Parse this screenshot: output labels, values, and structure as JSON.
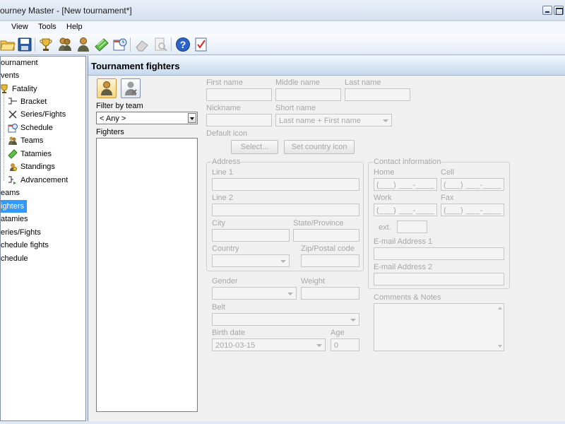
{
  "window": {
    "title": "ourney Master - [New tournament*]"
  },
  "menu": {
    "view": "View",
    "tools": "Tools",
    "help": "Help"
  },
  "toolbar": {
    "icons": [
      "open-folder-icon",
      "save-disk-icon",
      "trophy-icon",
      "fighters-icon",
      "fighter-icon",
      "tatami-icon",
      "schedule-icon",
      "eraser-icon",
      "print-preview-icon",
      "help-icon",
      "checklist-icon"
    ]
  },
  "tree": {
    "items": [
      {
        "label": "ournament"
      },
      {
        "label": "vents"
      },
      {
        "label": "Fatality"
      },
      {
        "label": "Bracket"
      },
      {
        "label": "Series/Fights"
      },
      {
        "label": "Schedule"
      },
      {
        "label": "Teams"
      },
      {
        "label": "Tatamies"
      },
      {
        "label": "Standings"
      },
      {
        "label": "Advancement"
      },
      {
        "label": "eams"
      },
      {
        "label": "ighters"
      },
      {
        "label": "atamies"
      },
      {
        "label": "eries/Fights"
      },
      {
        "label": "chedule fights"
      },
      {
        "label": "chedule"
      }
    ],
    "selected": "ighters"
  },
  "panel": {
    "title": "Tournament fighters",
    "filter_label": "Filter by team",
    "filter_value": "< Any >",
    "fighters_label": "Fighters"
  },
  "form": {
    "first_name": "First name",
    "middle_name": "Middle name",
    "last_name": "Last name",
    "nickname": "Nickname",
    "short_name": "Short name",
    "short_name_value": "Last name + First name",
    "default_icon": "Default icon",
    "select_button": "Select...",
    "country_icon_button": "Set country icon",
    "address": {
      "title": "Address",
      "line1": "Line 1",
      "line2": "Line 2",
      "city": "City",
      "state": "State/Province",
      "country": "Country",
      "zip": "Zip/Postal code"
    },
    "contact": {
      "title": "Contact information",
      "home": "Home",
      "cell": "Cell",
      "work": "Work",
      "fax": "Fax",
      "ext": "ext.",
      "email1": "E-mail Address 1",
      "email2": "E-mail Address 2",
      "phone_mask": "(___) ___-____"
    },
    "gender": "Gender",
    "weight": "Weight",
    "belt": "Belt",
    "birth_date": "Birth date",
    "birth_date_value": "2010-03-15",
    "age": "Age",
    "age_value": "0",
    "comments": "Comments & Notes"
  }
}
